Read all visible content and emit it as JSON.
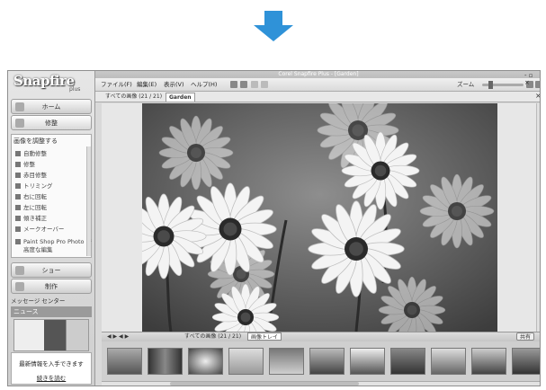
{
  "app": {
    "logo": "Snapfire",
    "logo_sub": "plus",
    "window_title": "Corel Snapfire Plus - [Garden]"
  },
  "sidebar": {
    "nav_home": "ホーム",
    "nav_edit": "修整",
    "panel_title": "画像を調整する",
    "panel_items": [
      "自動修整",
      "修整",
      "赤目修整",
      "トリミング",
      "右に回転",
      "左に回転",
      "傾き補正",
      "メークオーバー",
      "Paint Shop Pro Photo で",
      "高度な編集"
    ],
    "nav_show": "ショー",
    "nav_create": "制作",
    "message_center": "メッセージ センター",
    "news_title": "ニュース",
    "news_text": "最新情報を入手できます",
    "news_link": "続きを読む"
  },
  "menu": {
    "file": "ファイル(F)",
    "edit": "編集(E)",
    "view": "表示(V)",
    "help": "ヘルプ(H)",
    "zoom_label": "ズーム",
    "window_controls": "- ▫ ×"
  },
  "tabs": {
    "all_images": "すべての画像 (21 / 21)",
    "garden": "Garden",
    "close": "×"
  },
  "tray": {
    "label": "すべての画像 (21 / 21)",
    "image_tray": "画像トレイ",
    "share": "共有"
  },
  "colors": {
    "arrow": "#2f92d8"
  },
  "icons": {
    "arrow": "down-arrow-icon"
  }
}
